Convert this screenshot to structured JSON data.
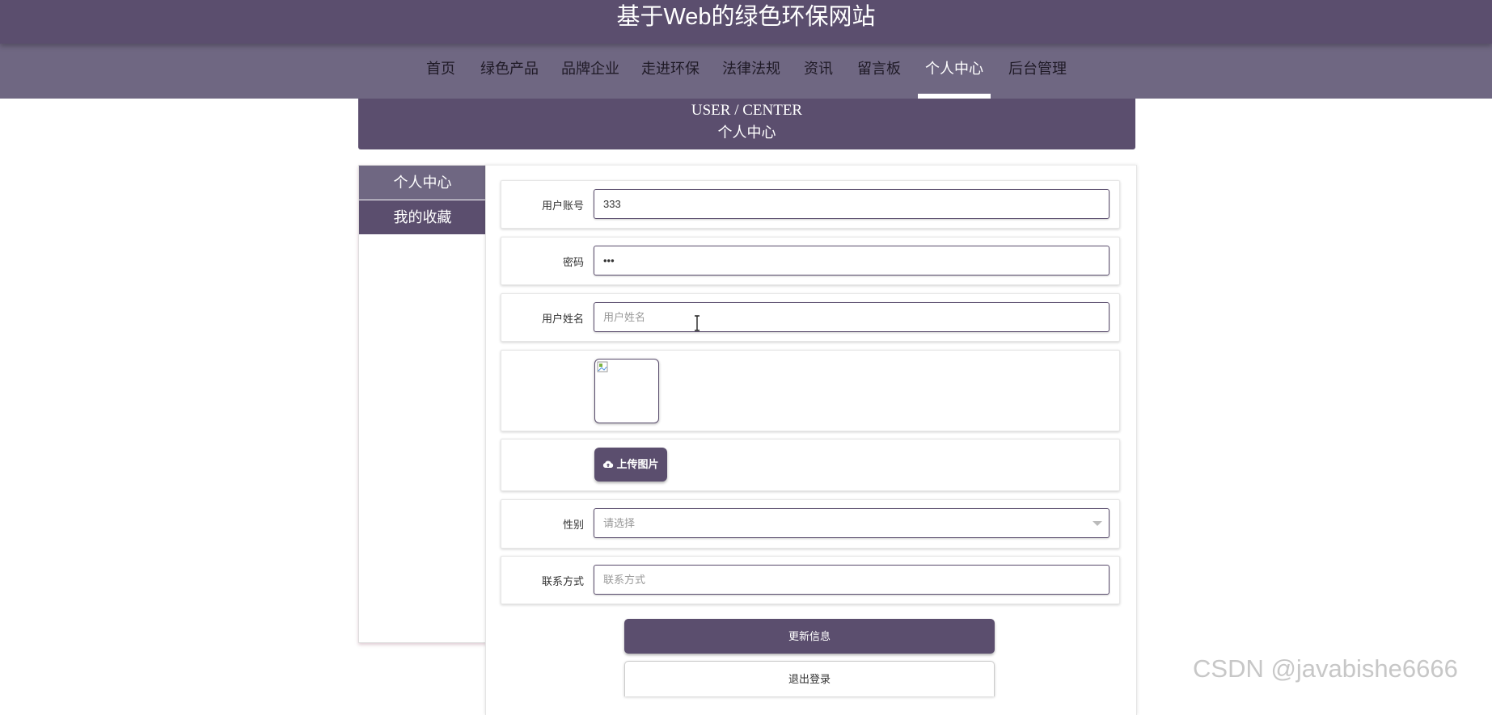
{
  "header": {
    "site_title": "基于Web的绿色环保网站"
  },
  "nav": {
    "items": [
      {
        "label": "首页"
      },
      {
        "label": "绿色产品"
      },
      {
        "label": "品牌企业"
      },
      {
        "label": "走进环保"
      },
      {
        "label": "法律法规"
      },
      {
        "label": "资讯"
      },
      {
        "label": "留言板"
      },
      {
        "label": "个人中心",
        "active": true
      },
      {
        "label": "后台管理"
      }
    ]
  },
  "banner": {
    "title_en": "USER / CENTER",
    "title_cn": "个人中心"
  },
  "sidebar": {
    "items": [
      {
        "label": "个人中心",
        "active": true
      },
      {
        "label": "我的收藏"
      }
    ]
  },
  "form": {
    "account": {
      "label": "用户账号",
      "value": "333"
    },
    "password": {
      "label": "密码",
      "value": "•••"
    },
    "name": {
      "label": "用户姓名",
      "placeholder": "用户姓名"
    },
    "upload": {
      "label": "上传图片",
      "icon": "cloud-upload-icon"
    },
    "gender": {
      "label": "性别",
      "placeholder": "请选择"
    },
    "contact": {
      "label": "联系方式",
      "placeholder": "联系方式"
    }
  },
  "actions": {
    "update_label": "更新信息",
    "logout_label": "退出登录"
  },
  "watermark": "CSDN @javabishe6666",
  "colors": {
    "primary": "#5b4e6e",
    "nav_bg": "#6f6782",
    "text_dark": "#1f1a26"
  }
}
